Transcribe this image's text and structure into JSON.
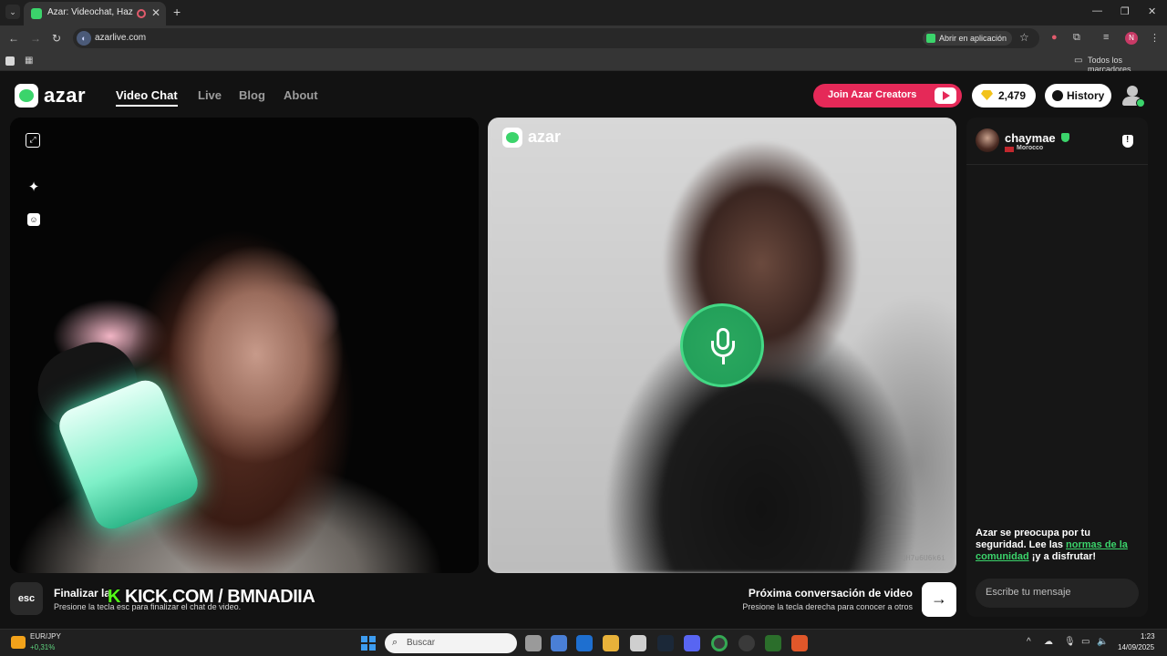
{
  "browser": {
    "tab_title": "Azar: Videochat, Haz nuevos",
    "url": "azarlive.com",
    "open_in_app": "Abrir en aplicación",
    "profile_initial": "N",
    "bookmarks_all": "Todos los marcadores",
    "icons": [
      "back-icon",
      "forward-icon",
      "reload-icon",
      "star-icon",
      "extensions-icon",
      "menu-icon"
    ]
  },
  "header": {
    "logo": "azar",
    "nav": [
      "Video Chat",
      "Live",
      "Blog",
      "About"
    ],
    "join_label": "Join Azar Creators",
    "gems": "2,479",
    "history_label": "History"
  },
  "remote": {
    "logo": "azar",
    "code": "QH7u6U6k6i"
  },
  "chat": {
    "name": "chaymae",
    "country": "Morocco",
    "notice_pre": "Azar se preocupa por tu seguridad. Lee las ",
    "notice_link": "normas de la comunidad",
    "notice_post": " ¡y a disfrutar!",
    "input_placeholder": "Escribe tu mensaje"
  },
  "bottom": {
    "esc": "esc",
    "end_title": "Finalizar la",
    "end_sub": "Presione la tecla esc para finalizar el chat de video.",
    "overlay_k": "K",
    "overlay_text": "KICK.COM / BMNADIIA",
    "next_title": "Próxima conversación de video",
    "next_sub": "Presione la tecla derecha para conocer a otros",
    "next_arrow": "→"
  },
  "taskbar": {
    "fx_pair": "EUR/JPY",
    "fx_change": "+0,31%",
    "search_label": "Buscar",
    "time": "1:23",
    "date": "14/09/2025"
  },
  "colors": {
    "accent_green": "#3bd46b",
    "join_red": "#e52958",
    "kick_green": "#53fc18"
  }
}
